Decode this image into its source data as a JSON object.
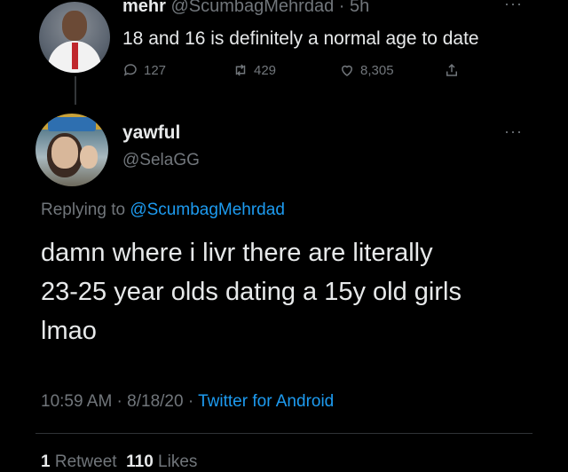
{
  "parent_tweet": {
    "display_name": "mehr",
    "handle": "@ScumbagMehrdad",
    "separator": " · ",
    "time": "5h",
    "more": "···",
    "text": "18 and 16 is definitely a normal age to date",
    "replies": "127",
    "retweets": "429",
    "likes": "8,305"
  },
  "reply_tweet": {
    "display_name": "yawful",
    "handle": "@SelaGG",
    "more": "···",
    "replying_prefix": "Replying to ",
    "replying_handle": "@ScumbagMehrdad",
    "text_lines": [
      "damn where i livr there are literally",
      "23-25 year olds dating a 15y old girls",
      "lmao"
    ],
    "time": "10:59 AM",
    "sep": " · ",
    "date": "8/18/20",
    "client": "Twitter for Android",
    "retweet_count": "1",
    "retweet_label": " Retweet  ",
    "like_count": "110",
    "like_label": " Likes"
  },
  "colors": {
    "background": "#000000",
    "text": "#e7e9ea",
    "muted": "#71767b",
    "link": "#1d9bf0"
  },
  "icons": [
    "reply-icon",
    "retweet-icon",
    "like-icon",
    "share-icon",
    "more-icon"
  ]
}
